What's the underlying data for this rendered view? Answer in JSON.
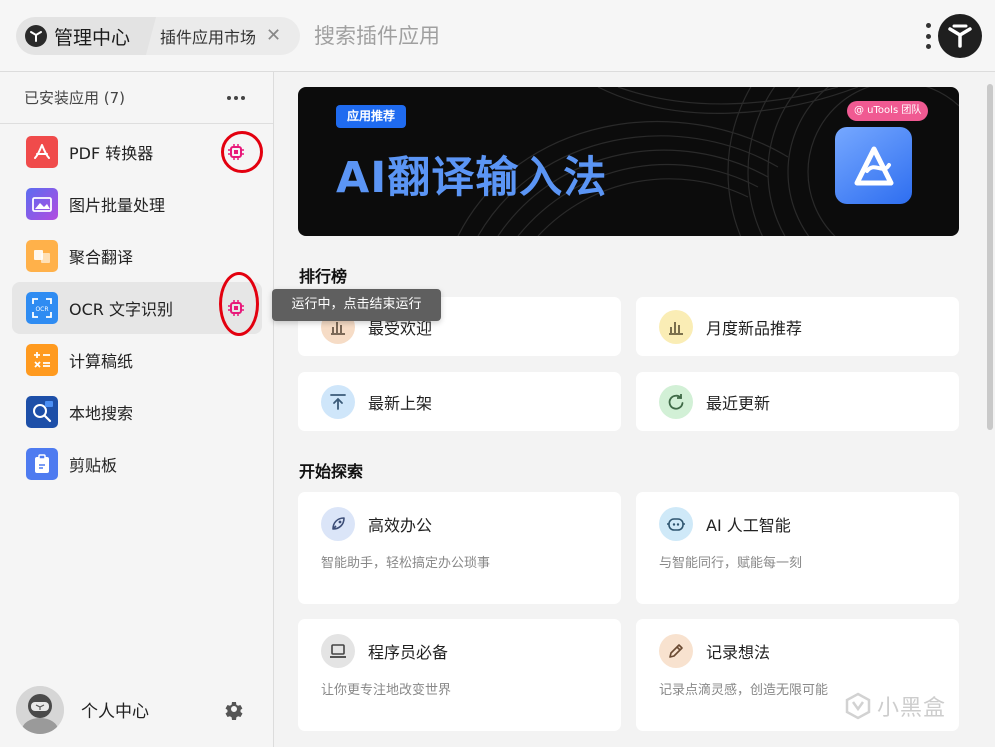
{
  "header": {
    "home_label": "管理中心",
    "tab_label": "插件应用市场",
    "search_placeholder": "搜索插件应用"
  },
  "sidebar": {
    "title": "已安装应用 (7)",
    "items": [
      {
        "label": "PDF 转换器",
        "icon": "pdf-icon",
        "color": "#f04b4b",
        "running": true
      },
      {
        "label": "图片批量处理",
        "icon": "image-icon",
        "color": "#8a4fe0",
        "running": false
      },
      {
        "label": "聚合翻译",
        "icon": "translate-icon",
        "color": "#ffb14a",
        "running": false
      },
      {
        "label": "OCR 文字识别",
        "icon": "ocr-icon",
        "color": "#2f8cf2",
        "running": true
      },
      {
        "label": "计算稿纸",
        "icon": "calculator-icon",
        "color": "#ff9a1f",
        "running": false
      },
      {
        "label": "本地搜索",
        "icon": "search-icon",
        "color": "#1d63c9",
        "running": false
      },
      {
        "label": "剪贴板",
        "icon": "clipboard-icon",
        "color": "#4e7bf0",
        "running": false
      }
    ],
    "user_label": "个人中心"
  },
  "tooltip": "运行中，点击结束运行",
  "banner": {
    "badge": "应用推荐",
    "title": "AI翻译输入法",
    "team_tag": "@ uTools 团队"
  },
  "ranking": {
    "title": "排行榜",
    "cards": [
      {
        "label": "最受欢迎",
        "icon": "bar-chart-icon",
        "color": "#f6dcc6"
      },
      {
        "label": "月度新品推荐",
        "icon": "bar-chart-icon",
        "color": "#faedb5"
      },
      {
        "label": "最新上架",
        "icon": "upload-icon",
        "color": "#cfe6fa"
      },
      {
        "label": "最近更新",
        "icon": "refresh-icon",
        "color": "#d2f0d6"
      }
    ]
  },
  "explore": {
    "title": "开始探索",
    "cards": [
      {
        "label": "高效办公",
        "desc": "智能助手，轻松搞定办公琐事",
        "icon": "rocket-icon",
        "color": "#dbe5f8"
      },
      {
        "label": "AI 人工智能",
        "desc": "与智能同行，赋能每一刻",
        "icon": "robot-icon",
        "color": "#cfe9f8"
      },
      {
        "label": "程序员必备",
        "desc": "让你更专注地改变世界",
        "icon": "laptop-icon",
        "color": "#e4e4e4"
      },
      {
        "label": "记录想法",
        "desc": "记录点滴灵感，创造无限可能",
        "icon": "pencil-icon",
        "color": "#f8e2cf"
      }
    ]
  },
  "watermark": "小黑盒"
}
